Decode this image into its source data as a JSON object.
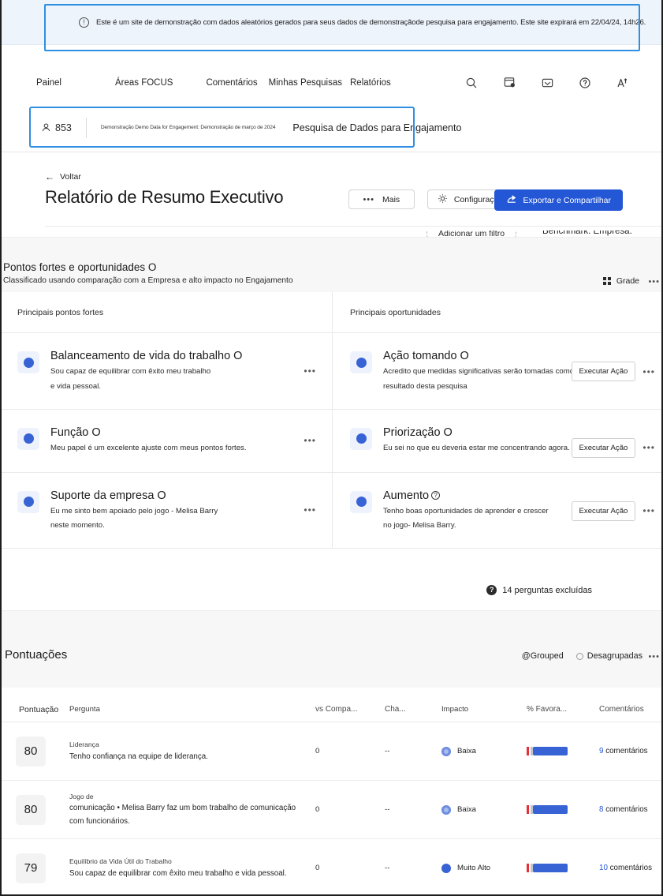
{
  "banner": {
    "icon": "info-circle-icon",
    "text": "Este é um site de demonstração com dados aleatórios gerados para seus dados de demonstraçãode pesquisa para engajamento. Este site expirará em 22/04/24, 14h26."
  },
  "nav": {
    "links": [
      "Painel",
      "Áreas FOCUS",
      "Comentários",
      "Minhas Pesquisas",
      "Relatórios"
    ],
    "icons": [
      "search-icon",
      "calendar-settings-icon",
      "inbox-icon",
      "help-circle-icon",
      "translate-icon"
    ]
  },
  "survey_bar": {
    "respondent_count": "853",
    "subtitle": "Demonstração Demo Data for Engagement: Demonstração de março de 2024",
    "title": "Pesquisa de Dados para Engajamento",
    "filter_label": "Adicionar um filtro",
    "benchmark": "Benchmark: Empresa."
  },
  "report": {
    "back_label": "Voltar",
    "title": "Relatório de Resumo Executivo",
    "buttons": {
      "more": "Mais",
      "settings": "Configurações",
      "export": "Exportar e Compartilhar"
    }
  },
  "strengths_section": {
    "title": "Pontos fortes e oportunidades O",
    "subtitle": "Classificado usando comparação com a Empresa e alto impacto no Engajamento",
    "view_toggle": "Grade",
    "col_left_header": "Principais pontos fortes",
    "col_right_header": "Principais oportunidades",
    "action_label": "Executar Ação",
    "strengths": [
      {
        "title": "Balanceamento de vida do trabalho O",
        "desc_lines": [
          "Sou capaz de equilibrar com êxito meu trabalho",
          "e vida pessoal."
        ]
      },
      {
        "title": "Função O",
        "desc_lines": [
          "Meu papel é um excelente ajuste com meus pontos fortes."
        ]
      },
      {
        "title": "Suporte da empresa O",
        "desc_lines": [
          "Eu me sinto bem apoiado pelo jogo - Melisa Barry",
          "neste momento."
        ]
      }
    ],
    "opportunities": [
      {
        "title": "Ação tomando O",
        "desc_lines": [
          "Acredito que medidas significativas serão tomadas como",
          "resultado desta pesquisa"
        ]
      },
      {
        "title": "Priorização O",
        "desc_lines": [
          "Eu sei no que eu deveria estar me concentrando agora."
        ]
      },
      {
        "title": "Aumento",
        "has_help_icon": true,
        "desc_lines": [
          "Tenho boas oportunidades de aprender e crescer",
          "no jogo- Melisa Barry."
        ]
      }
    ],
    "excluded": "14 perguntas excluídas"
  },
  "scores_section": {
    "title": "Pontuações",
    "grouped_label": "@Grouped",
    "ungrouped_label": "Desagrupadas",
    "columns": [
      "Pontuação",
      "Pergunta",
      "vs Compa...",
      "Cha...",
      "Impacto",
      "% Favora...",
      "Comentários"
    ],
    "rows": [
      {
        "score": "80",
        "category": "Liderança",
        "question": "Tenho confiança na equipe de liderança.",
        "vs_company": "0",
        "change": "--",
        "impact": "Baixa",
        "impact_level": "low",
        "favorable_pct": 72,
        "comments_count": "9",
        "comments_label": "comentários"
      },
      {
        "score": "80",
        "category": "Jogo de",
        "question": "comunicação • Melisa Barry faz um bom trabalho de comunicação",
        "question2": "com funcionários.",
        "vs_company": "0",
        "change": "--",
        "impact": "Baixa",
        "impact_level": "low",
        "favorable_pct": 72,
        "comments_count": "8",
        "comments_label": "comentários"
      },
      {
        "score": "79",
        "category": "Equilíbrio da Vida Útil do Trabalho",
        "question": "Sou capaz de equilibrar com êxito meu trabalho e vida pessoal.",
        "vs_company": "0",
        "change": "--",
        "impact": "Muito Alto",
        "impact_level": "high",
        "favorable_pct": 72,
        "comments_count": "10",
        "comments_label": "comentários"
      }
    ]
  },
  "colors": {
    "accent": "#2457d6",
    "dot": "#3763d4",
    "highlight": "#2f8fe0",
    "banner_bg": "#eef4fc"
  }
}
